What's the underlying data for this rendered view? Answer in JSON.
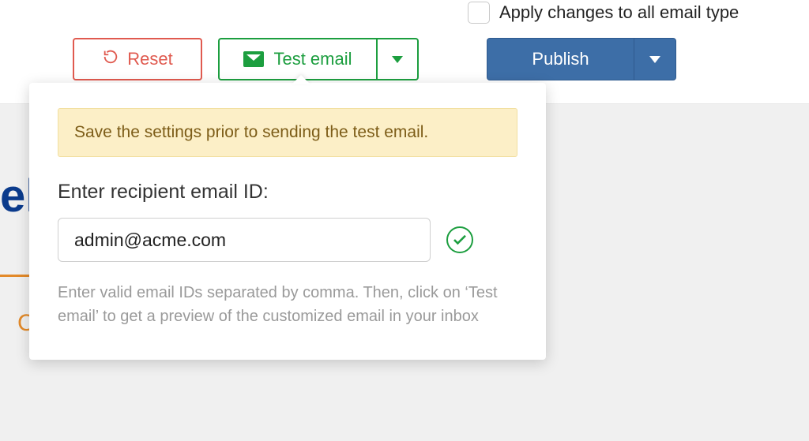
{
  "apply_all": {
    "label": "Apply changes to all email type",
    "checked": false
  },
  "toolbar": {
    "reset_label": "Reset",
    "test_email_label": "Test email",
    "publish_label": "Publish"
  },
  "popover": {
    "notice": "Save the settings prior to sending the test email.",
    "field_label": "Enter recipient email ID:",
    "email_value": "admin@acme.com",
    "helper": "Enter valid email IDs separated by comma. Then, click on ‘Test email’ to get a preview of the customized email in your inbox"
  },
  "colors": {
    "reset": "#e05a4f",
    "test": "#1c9e3f",
    "publish": "#3d6ea7",
    "notice_bg": "#fcefc7",
    "notice_text": "#7d5d18"
  }
}
